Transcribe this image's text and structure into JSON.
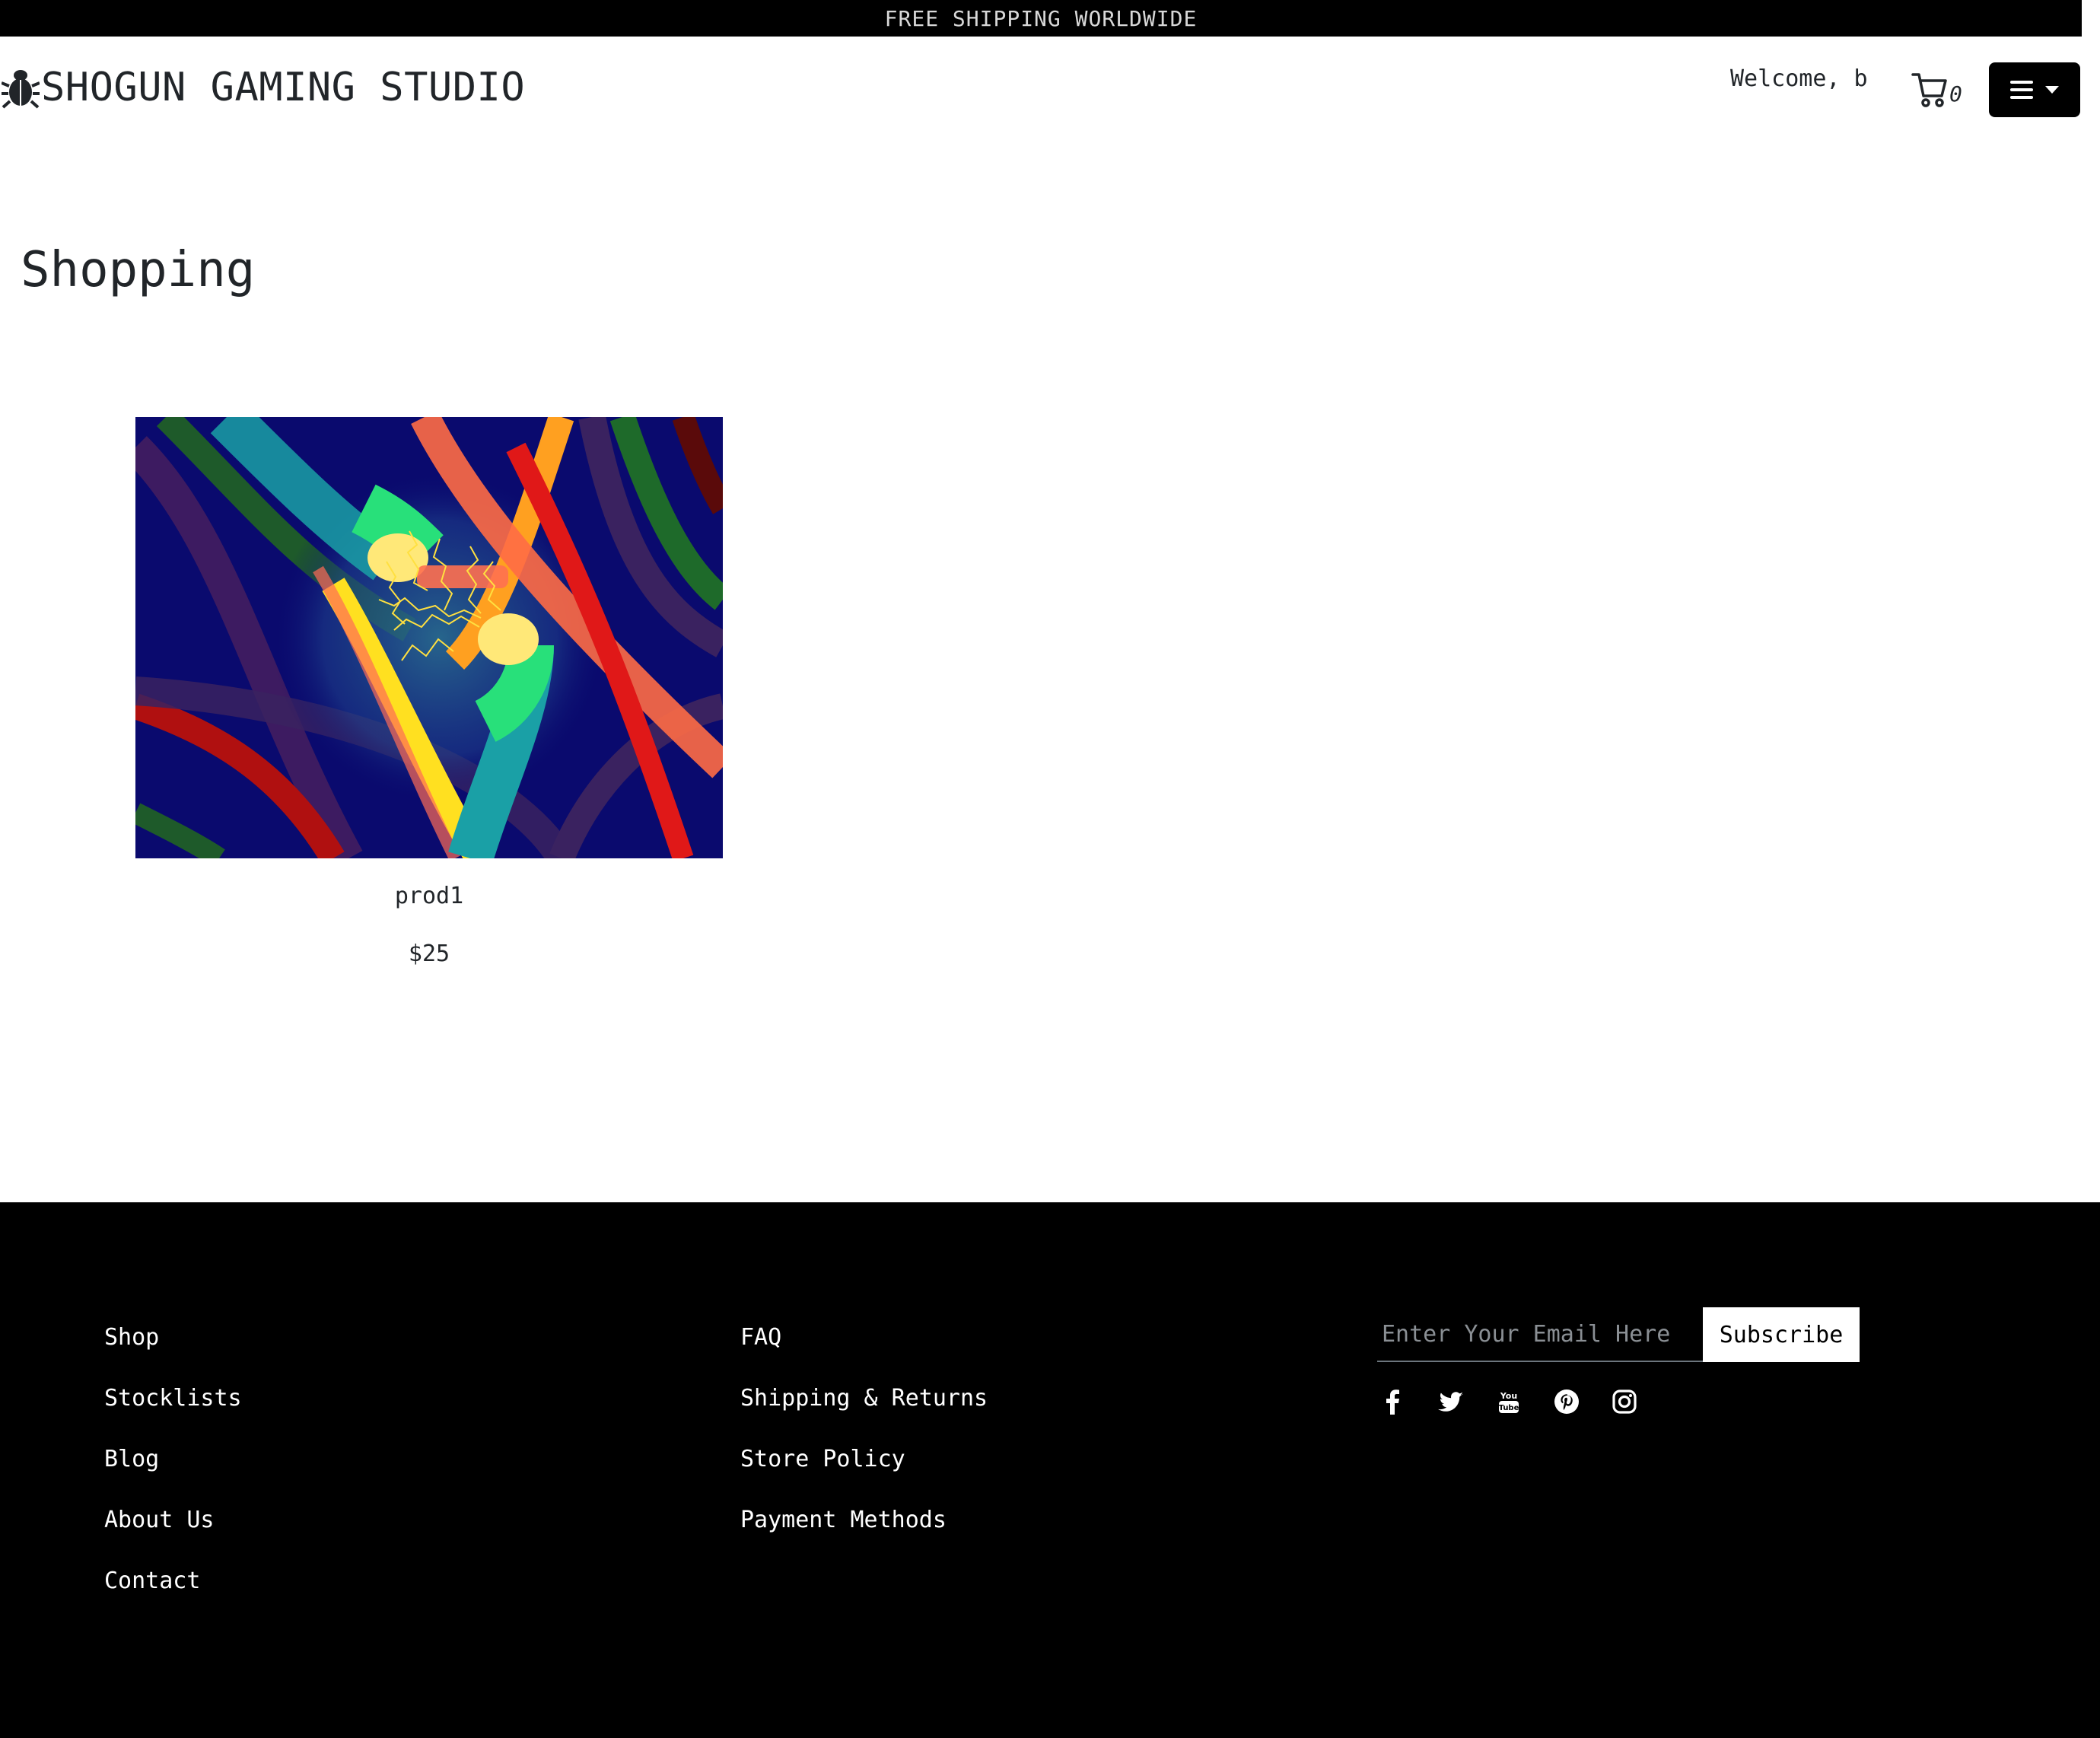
{
  "announcement": "FREE SHIPPING WORLDWIDE",
  "header": {
    "brand_name": "SHOGUN GAMING STUDIO",
    "brand_icon": "bug-icon",
    "welcome_text": "Welcome, b",
    "cart_count": "0",
    "cart_icon": "cart-icon",
    "menu_icon": "bars-icon"
  },
  "main": {
    "title": "Shopping",
    "products": [
      {
        "name": "prod1",
        "price": "$25"
      }
    ]
  },
  "footer": {
    "col1": [
      "Shop",
      "Stocklists",
      "Blog",
      "About Us",
      "Contact"
    ],
    "col2": [
      "FAQ",
      "Shipping & Returns",
      "Store Policy",
      "Payment Methods"
    ],
    "newsletter": {
      "placeholder": "Enter Your Email Here",
      "button_label": "Subscribe"
    },
    "social": [
      "facebook-icon",
      "twitter-icon",
      "youtube-icon",
      "pinterest-icon",
      "instagram-icon"
    ]
  },
  "colors": {
    "topbar_bg": "#000000",
    "footer_bg": "#000000",
    "menu_button_bg": "#000000",
    "art_background": "#0a0a6e"
  }
}
